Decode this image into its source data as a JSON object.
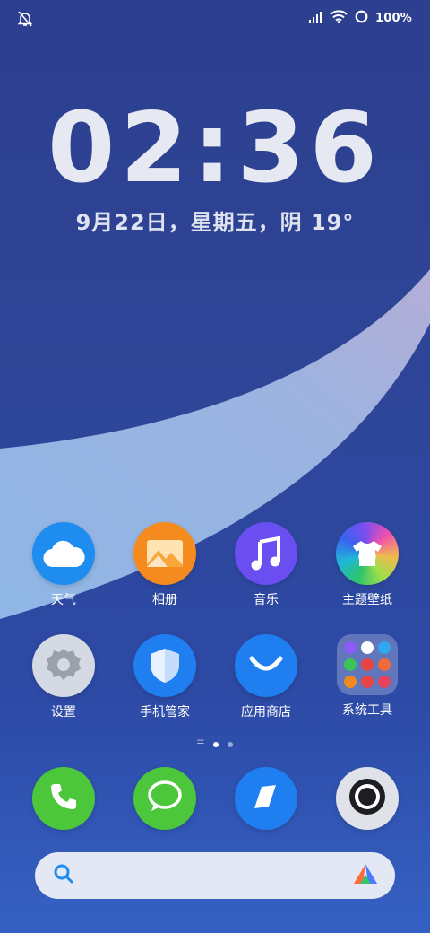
{
  "status_bar": {
    "battery_text": "100%"
  },
  "lock": {
    "time": "02:36",
    "date": "9月22日，星期五，阴 19°"
  },
  "apps": [
    {
      "label": "天气"
    },
    {
      "label": "相册"
    },
    {
      "label": "音乐"
    },
    {
      "label": "主题壁纸"
    },
    {
      "label": "设置"
    },
    {
      "label": "手机管家"
    },
    {
      "label": "应用商店"
    },
    {
      "label": "系统工具"
    }
  ],
  "dock": [
    "phone-icon",
    "messages-icon",
    "browser-icon",
    "camera-icon"
  ],
  "search": {
    "placeholder": ""
  },
  "colors": {
    "weather": "#1f8cf0",
    "gallery": "#f58a1f",
    "music": "#6a4ef0",
    "phone": "#4cc63a",
    "messages": "#4cc63a",
    "browser": "#1f7ff0",
    "camera": "#dfe2e8"
  }
}
